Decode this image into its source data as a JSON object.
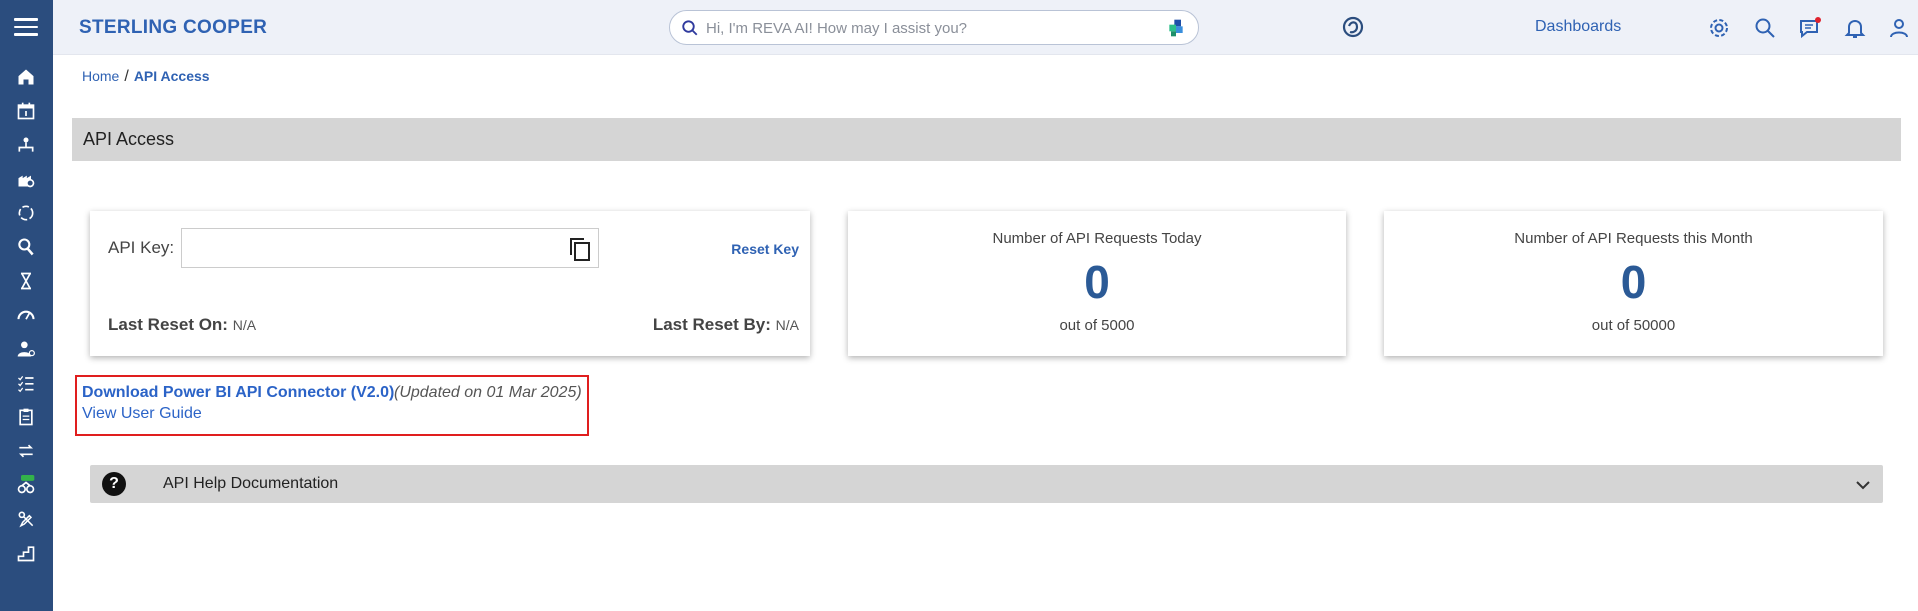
{
  "app": {
    "brand": "STERLING COOPER"
  },
  "header": {
    "search_placeholder": "Hi, I'm REVA AI! How may I assist you?",
    "dashboards_label": "Dashboards"
  },
  "sidebar": {
    "items": [
      "home-icon",
      "calendar-icon",
      "org-chart-icon",
      "factory-icon",
      "refresh-icon",
      "search-person-icon",
      "hourglass-icon",
      "gauge-icon",
      "user-settings-icon",
      "checklist-icon",
      "clipboard-icon",
      "transfer-icon",
      "new-feature-icon",
      "pencil-tools-icon",
      "stairs-icon"
    ]
  },
  "breadcrumb": {
    "home": "Home",
    "separator": "/",
    "current": "API Access"
  },
  "page": {
    "title": "API Access"
  },
  "api_key_card": {
    "api_key_label": "API Key:",
    "api_key_value": "",
    "reset_key_label": "Reset Key",
    "last_reset_on_label": "Last Reset On:",
    "last_reset_on_value": "N/A",
    "last_reset_by_label": "Last Reset By:",
    "last_reset_by_value": "N/A"
  },
  "stats": {
    "today": {
      "title": "Number of API Requests Today",
      "value": "0",
      "sub": "out of 5000"
    },
    "month": {
      "title": "Number of API Requests this Month",
      "value": "0",
      "sub": "out of 50000"
    }
  },
  "downloads": {
    "connector_link": "Download Power BI API Connector (V2.0)",
    "connector_note": "(Updated on 01 Mar 2025)",
    "guide_link": "View User Guide"
  },
  "help": {
    "icon_text": "?",
    "title": "API Help Documentation"
  },
  "colors": {
    "sidebar": "#2b4d7e",
    "accent": "#2f62b3",
    "highlight_border": "#e01e1e"
  }
}
